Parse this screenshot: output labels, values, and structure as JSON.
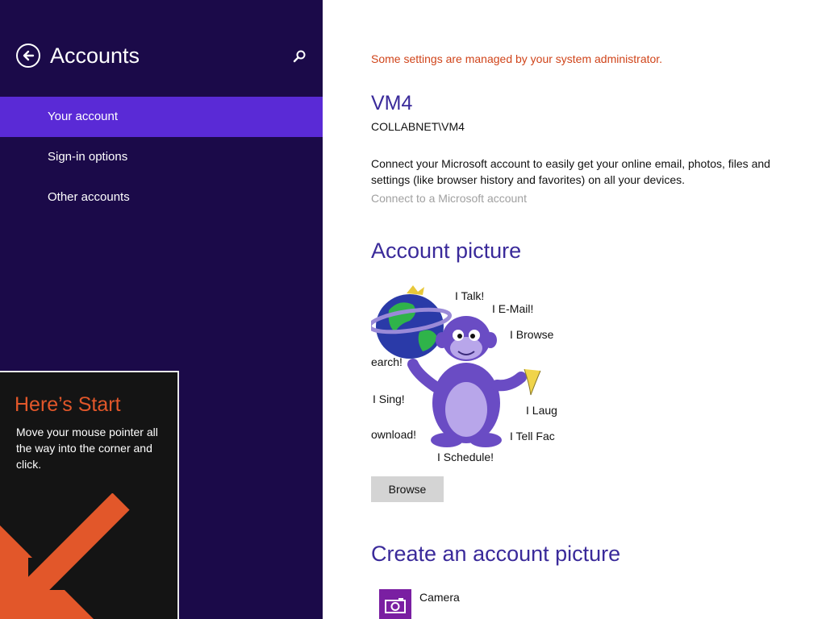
{
  "sidebar": {
    "title": "Accounts",
    "items": [
      {
        "label": "Your account",
        "selected": true
      },
      {
        "label": "Sign-in options",
        "selected": false
      },
      {
        "label": "Other accounts",
        "selected": false
      }
    ],
    "icons": {
      "back": "back-arrow-icon",
      "search": "search-icon"
    }
  },
  "start_tip": {
    "title": "Here’s Start",
    "body": "Move your mouse pointer all the way into the corner and click.",
    "arrow_icon": "corner-arrow-icon"
  },
  "main": {
    "admin_note": "Some settings are managed by your system administrator.",
    "account_name": "VM4",
    "account_domain": "COLLABNET\\VM4",
    "connect_description": "Connect your Microsoft account to easily get your online email, photos, files and settings (like browser history and favorites) on all your devices.",
    "connect_link": "Connect to a Microsoft account",
    "picture_heading": "Account picture",
    "picture_labels": {
      "talk": "I Talk!",
      "email": "I E-Mail!",
      "browse": "I Browse",
      "search": "earch!",
      "sing": "I Sing!",
      "laugh": "I Laug",
      "download": "ownload!",
      "tell": "I Tell Fac",
      "schedule": "I Schedule!"
    },
    "browse_button": "Browse",
    "create_heading": "Create an account picture",
    "camera_label": "Camera"
  },
  "colors": {
    "sidebar_bg": "#1b0a49",
    "selected_item": "#5a2ad6",
    "heading": "#3a2a9a",
    "warning": "#d0441a",
    "tip_accent": "#e2572a",
    "camera_tile": "#7a1fa2"
  }
}
